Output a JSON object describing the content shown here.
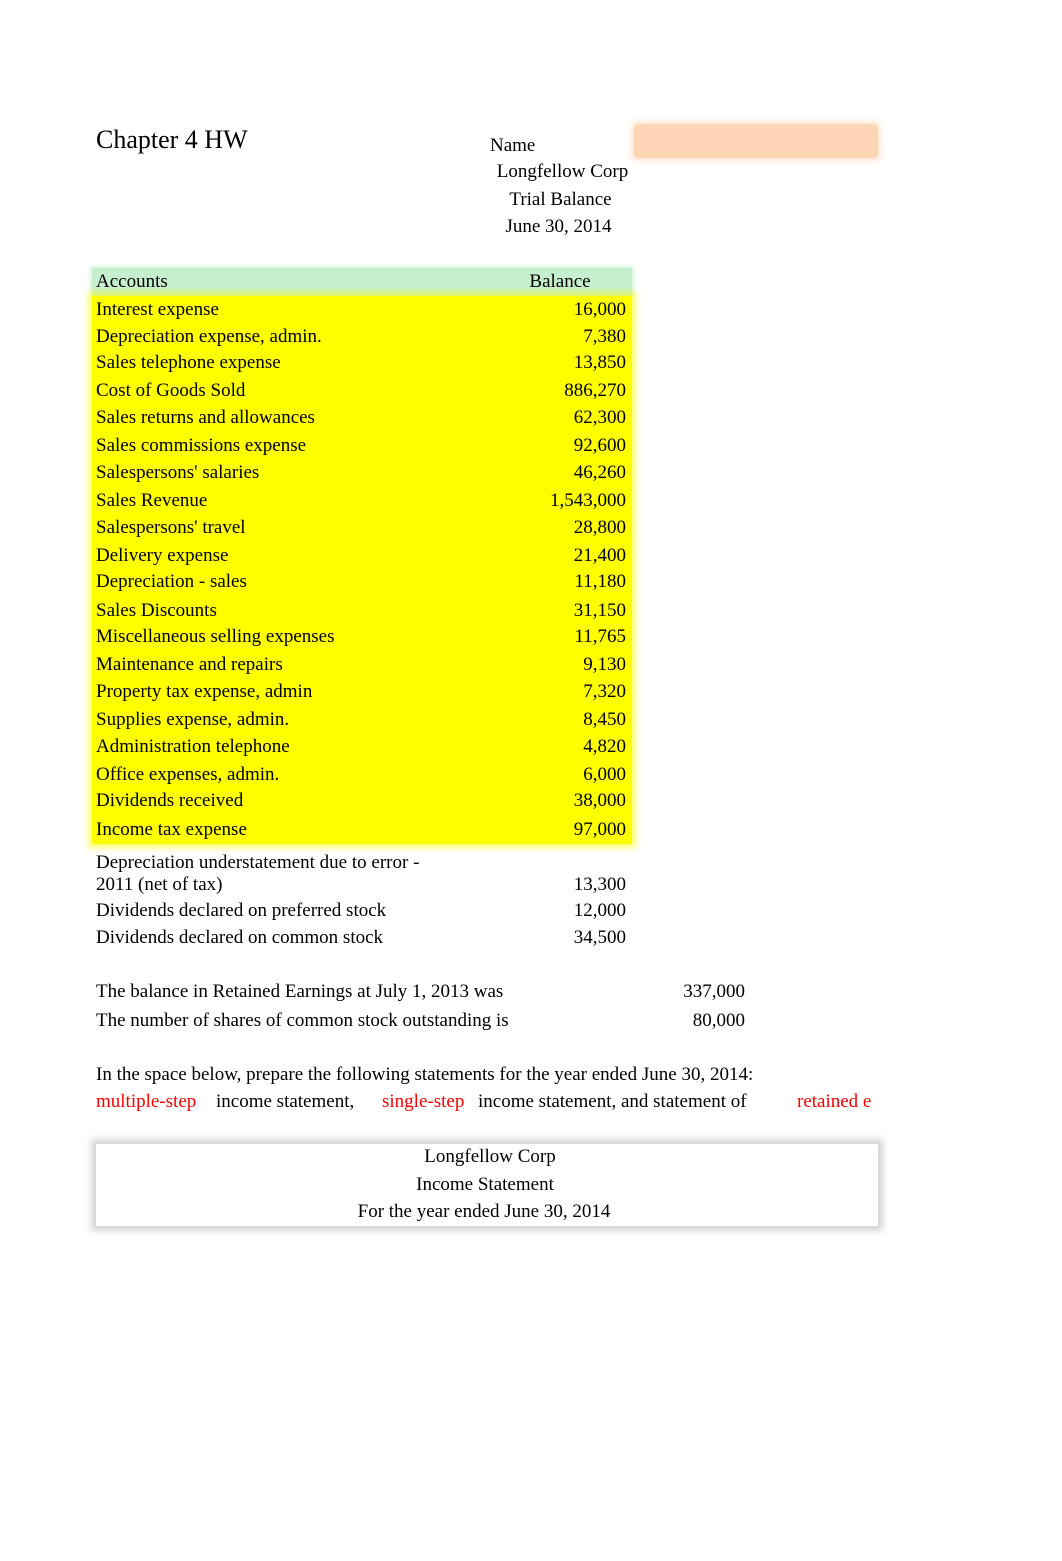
{
  "title": "Chapter 4 HW",
  "name_label": "Name",
  "name_value": "",
  "header": {
    "company": "Longfellow Corp",
    "statement": "Trial Balance",
    "date": "June 30, 2014"
  },
  "trial_balance": {
    "columns": [
      "Accounts",
      "Balance"
    ],
    "rows": [
      {
        "account": "Interest expense",
        "balance": "16,000"
      },
      {
        "account": "Depreciation expense, admin.",
        "balance": "7,380"
      },
      {
        "account": "Sales telephone expense",
        "balance": "13,850"
      },
      {
        "account": "Cost of Goods Sold",
        "balance": "886,270"
      },
      {
        "account": "Sales returns and allowances",
        "balance": "62,300"
      },
      {
        "account": "Sales commissions expense",
        "balance": "92,600"
      },
      {
        "account": "Salespersons' salaries",
        "balance": "46,260"
      },
      {
        "account": "Sales Revenue",
        "balance": "1,543,000"
      },
      {
        "account": "Salespersons' travel",
        "balance": "28,800"
      },
      {
        "account": "Delivery expense",
        "balance": "21,400"
      },
      {
        "account": "Depreciation - sales",
        "balance": "11,180"
      },
      {
        "account": "Sales Discounts",
        "balance": "31,150"
      },
      {
        "account": "Miscellaneous selling expenses",
        "balance": "11,765"
      },
      {
        "account": "Maintenance and repairs",
        "balance": "9,130"
      },
      {
        "account": "Property tax expense, admin",
        "balance": "7,320"
      },
      {
        "account": "Supplies expense, admin.",
        "balance": "8,450"
      },
      {
        "account": "Administration telephone",
        "balance": "4,820"
      },
      {
        "account": "Office expenses, admin.",
        "balance": "6,000"
      },
      {
        "account": "Dividends received",
        "balance": "38,000"
      },
      {
        "account": "Income tax expense",
        "balance": "97,000"
      }
    ]
  },
  "other_items": [
    {
      "line1": "Depreciation understatement due to error -",
      "line2": "2011 (net of tax)",
      "balance": "13,300"
    },
    {
      "account": "Dividends declared on preferred stock",
      "balance": "12,000"
    },
    {
      "account": "Dividends declared on common stock",
      "balance": "34,500"
    }
  ],
  "facts": [
    {
      "text": "The balance in Retained Earnings at July 1, 2013 was",
      "value": "337,000"
    },
    {
      "text": "The number of shares of common stock outstanding is",
      "value": "80,000"
    }
  ],
  "instructions": {
    "line1": "In the space below, prepare the following statements for the year ended June 30, 2014:",
    "part1_red": "multiple-step",
    "part2": "income statement,",
    "part3_red": "single-step",
    "part4": "income statement, and statement of",
    "part5_red": "retained e"
  },
  "income_statement_header": {
    "company": "Longfellow Corp",
    "statement": "Income Statement",
    "period": "For the year ended June 30, 2014"
  },
  "colors": {
    "header_fill": "#c6efce",
    "data_fill": "#ffff00",
    "name_field_fill": "#fcd5b5",
    "highlight_text": "#ff0000"
  }
}
